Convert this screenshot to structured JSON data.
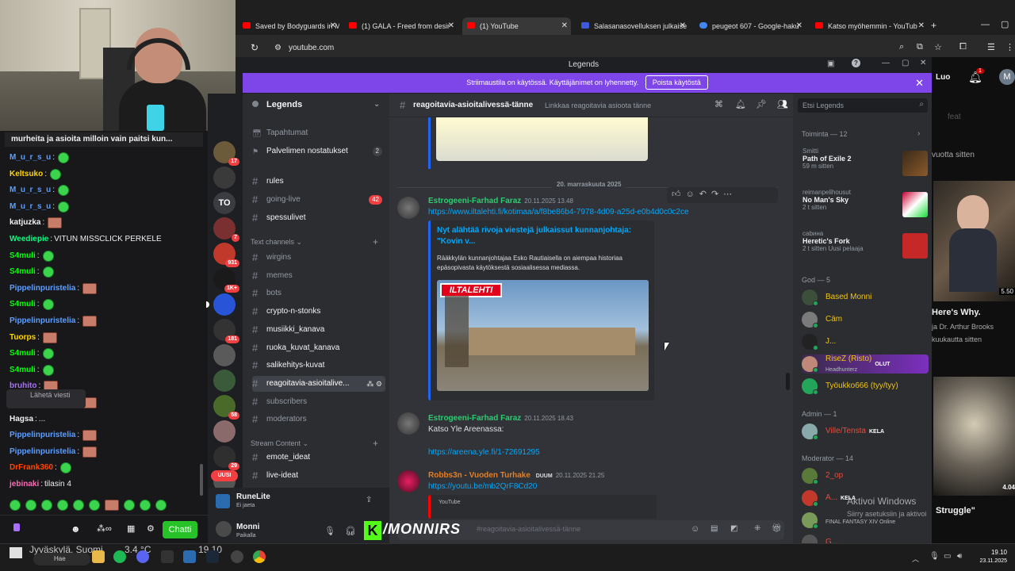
{
  "chat": {
    "pinned": "murheita ja asioita milloin vain paitsi kun...",
    "messages": [
      {
        "user": "M_u_r_s_u",
        "text": "",
        "color": "#5c9eff"
      },
      {
        "user": "Keltsuko",
        "text": "",
        "color": "#ffd600"
      },
      {
        "user": "M_u_r_s_u",
        "text": "",
        "color": "#5c9eff"
      },
      {
        "user": "M_u_r_s_u",
        "text": "",
        "color": "#5c9eff"
      },
      {
        "user": "katjuzka",
        "text": "",
        "color": "#efeff1"
      },
      {
        "user": "Weediepie",
        "text": "VITUN MISSCLICK PERKELE",
        "color": "#00ff7f"
      },
      {
        "user": "S4muli",
        "text": "",
        "color": "#00ff00"
      },
      {
        "user": "S4muli",
        "text": "",
        "color": "#00ff00"
      },
      {
        "user": "Pippelinpuristelia",
        "text": "",
        "color": "#5c9eff"
      },
      {
        "user": "S4muli",
        "text": "",
        "color": "#00ff00"
      },
      {
        "user": "Pippelinpuristelia",
        "text": "",
        "color": "#5c9eff"
      },
      {
        "user": "Tuorps",
        "text": "",
        "color": "#ffd600"
      },
      {
        "user": "S4muli",
        "text": "",
        "color": "#00ff00"
      },
      {
        "user": "S4muli",
        "text": "",
        "color": "#00ff00"
      },
      {
        "user": "bruhito",
        "text": "",
        "color": "#a970ff"
      },
      {
        "user": "Pippelinpuristelia",
        "text": "",
        "color": "#5c9eff"
      },
      {
        "user": "Hagsa",
        "text": "...",
        "color": "#efeff1"
      },
      {
        "user": "Pippelinpuristelia",
        "text": "",
        "color": "#5c9eff"
      },
      {
        "user": "Pippelinpuristelia",
        "text": "",
        "color": "#5c9eff"
      },
      {
        "user": "DrFrank360",
        "text": "",
        "color": "#ff4500"
      },
      {
        "user": "jebinaki",
        "text": "tilasin 4",
        "color": "#ff69b4"
      }
    ],
    "input_placeholder": "Lähetä viesti",
    "send_label": "Chatti"
  },
  "browser": {
    "tabs": [
      {
        "label": "Saved by Bodyguards in Ma",
        "active": false
      },
      {
        "label": "(1) GALA - Freed from desir",
        "active": false
      },
      {
        "label": "(1) YouTube",
        "active": true
      },
      {
        "label": "Salasanasovelluksen julkaise",
        "active": false
      },
      {
        "label": "peugeot 607 - Google-haku",
        "active": false
      },
      {
        "label": "Katso myöhemmin - YouTub",
        "active": false
      }
    ],
    "url": "youtube.com"
  },
  "discord": {
    "window_title": "Legends",
    "banner": {
      "text": "Striimaustila on käytössä. Käyttäjänimet on lyhennetty.",
      "button": "Poista käytöstä"
    },
    "server_name": "Legends",
    "guild_badges": [
      "17",
      "TO",
      "7",
      "931",
      "1K+",
      "181",
      "58",
      "29"
    ],
    "new_label": "UUSI",
    "top_items": [
      {
        "label": "Tapahtumat",
        "count": ""
      },
      {
        "label": "Palvelimen nostatukset",
        "count": "2"
      }
    ],
    "channels_a": [
      {
        "name": "rules",
        "count": ""
      },
      {
        "name": "going-live",
        "count": "42"
      },
      {
        "name": "spessulivet",
        "count": ""
      }
    ],
    "category_text": "Text channels",
    "channels_b": [
      {
        "name": "wirgins"
      },
      {
        "name": "memes"
      },
      {
        "name": "bots"
      },
      {
        "name": "crypto-n-stonks"
      },
      {
        "name": "musiikki_kanava"
      },
      {
        "name": "ruoka_kuvat_kanava"
      },
      {
        "name": "salikehitys-kuvat"
      },
      {
        "name": "reagoitavia-asioitalive..."
      },
      {
        "name": "subscribers"
      },
      {
        "name": "moderators"
      }
    ],
    "category_stream": "Stream Content",
    "channels_c": [
      {
        "name": "emote_ideat"
      },
      {
        "name": "live-ideat"
      }
    ],
    "voice_user": {
      "name": "RuneLite",
      "status": "Ei jaeta"
    },
    "me": {
      "name": "Monni",
      "status": "Paikalla"
    },
    "channel": {
      "name": "reagoitavia-asioitalivessä-tänne",
      "topic": "Linkkaa reagoitavia asioota tänne"
    },
    "date_divider": "20. marraskuuta 2025",
    "messages": [
      {
        "author": "Estrogeeni-Farhad Faraz",
        "time": "20.11.2025 13.48",
        "link": "https://www.iltalehti.fi/kotimaa/a/f8be86b4-7978-4d09-a25d-e0b4d0c0c2ce",
        "embed_title": "Nyt alähtää rivoja viestejä julkaissut kunnanjohtaja: \"Kovin v...",
        "embed_desc": "Rääkkylän kunnanjohtajaa Esko Rautiaisella on aiempaa historiaa epäsopivasta käytöksestä sosiaalisessa mediassa.",
        "embed_brand": "ILTALEHTI"
      },
      {
        "author": "Estrogeeni-Farhad Faraz",
        "time": "20.11.2025 18.43",
        "text": "Katso Yle Areenassa:",
        "link": "https://areena.yle.fi/1-72691295"
      },
      {
        "author": "Robbs3n - Vuoden Turhake",
        "tag": "DUUM",
        "time": "20.11.2025 21.25",
        "link": "https://youtu.be/mb2QrF8Cd20",
        "embed_provider": "YouTube"
      }
    ],
    "composer_placeholder": "#reagoitavia-asioitalivessä-tänne",
    "search_placeholder": "Etsi Legends",
    "activity_header": "Toiminta — 12",
    "activities": [
      {
        "user": "Smitti",
        "game": "Path of Exile 2",
        "time": "59 m sitten",
        "extra": ""
      },
      {
        "user": "reimanpelihousut",
        "game": "No Man's Sky",
        "time": "2 t sitten",
        "extra": ""
      },
      {
        "user": "саbина",
        "game": "Heretic's Fork",
        "time": "2 t sitten",
        "extra": "Uusi pelaaja"
      }
    ],
    "group_god": "God — 5",
    "god_members": [
      {
        "name": "Based Monni",
        "tag": "",
        "sub": ""
      },
      {
        "name": "Cäm",
        "tag": "",
        "sub": ""
      },
      {
        "name": "J...",
        "tag": "",
        "sub": ""
      },
      {
        "name": "RiseZ (Risto)",
        "tag": "OLUT",
        "sub": "Headhunterz"
      },
      {
        "name": "Työukko666 (tyy/tyy)",
        "tag": "",
        "sub": ""
      }
    ],
    "group_admin": "Admin — 1",
    "admin_members": [
      {
        "name": "Ville/Tensta",
        "tag": "KELA",
        "sub": ""
      }
    ],
    "group_mod": "Moderator — 14",
    "mod_members": [
      {
        "name": "2_op",
        "tag": "",
        "sub": ""
      },
      {
        "name": "A...",
        "tag": "KELA",
        "sub": ""
      },
      {
        "name": "",
        "tag": "",
        "sub": "FINAL FANTASY XIV Online"
      },
      {
        "name": "G...",
        "tag": "",
        "sub": ""
      }
    ]
  },
  "youtube": {
    "create": "Luo",
    "notif_count": "1",
    "avatar": "M",
    "feat": "feat",
    "ago1": "vuotta sitten",
    "video_time": "5.50",
    "title1": "Here's Why.",
    "channel1": "ja Dr. Arthur Brooks",
    "ago2": "kuukautta sitten",
    "video_time2": "4.04",
    "title2": "Struggle\""
  },
  "overlay": {
    "brand": "/MONNIRS",
    "weather": "Jyväskylä, Suomi",
    "temp": "3.4 °C",
    "time": "19.10"
  },
  "windows": {
    "activate": "Aktivoi Windows",
    "activate_sub": "Siirry asetuksiin ja aktivoi",
    "search": "Hae",
    "clock": "19.10",
    "date": "23.11.2025"
  }
}
